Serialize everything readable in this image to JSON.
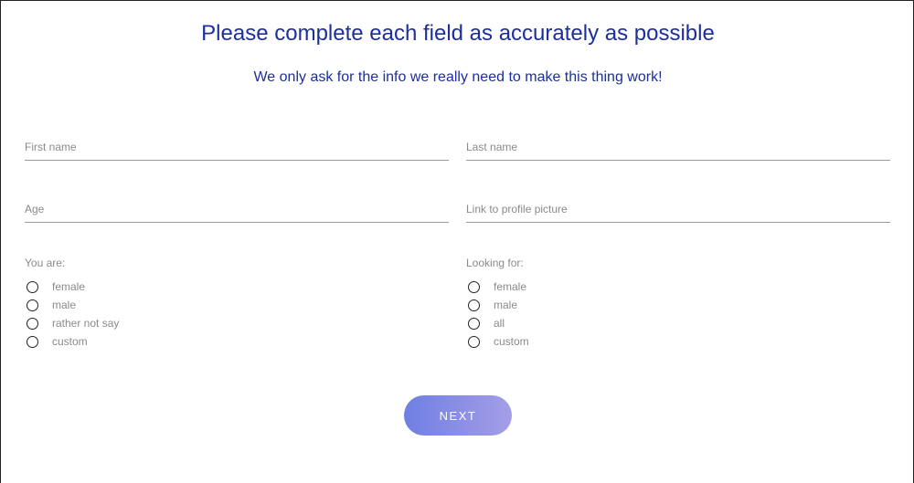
{
  "header": {
    "title": "Please complete each field as accurately as possible",
    "subtitle": "We only ask for the info we really need to make this thing work!"
  },
  "form": {
    "first_name": {
      "placeholder": "First name",
      "value": ""
    },
    "last_name": {
      "placeholder": "Last name",
      "value": ""
    },
    "age": {
      "placeholder": "Age",
      "value": ""
    },
    "profile_picture": {
      "placeholder": "Link to profile picture",
      "value": ""
    },
    "you_are": {
      "label": "You are:",
      "options": [
        "female",
        "male",
        "rather not say",
        "custom"
      ],
      "selected": null
    },
    "looking_for": {
      "label": "Looking for:",
      "options": [
        "female",
        "male",
        "all",
        "custom"
      ],
      "selected": null
    },
    "next_label": "NEXT"
  },
  "colors": {
    "heading": "#1c2f9c",
    "muted_text": "#8a8a8a",
    "field_underline": "#9a9a9a",
    "button_gradient_start": "#6f7fe3",
    "button_gradient_end": "#a49ee6",
    "button_text": "#ffffff"
  },
  "icons": {
    "radio_unselected": "radio-empty-circle-icon"
  }
}
